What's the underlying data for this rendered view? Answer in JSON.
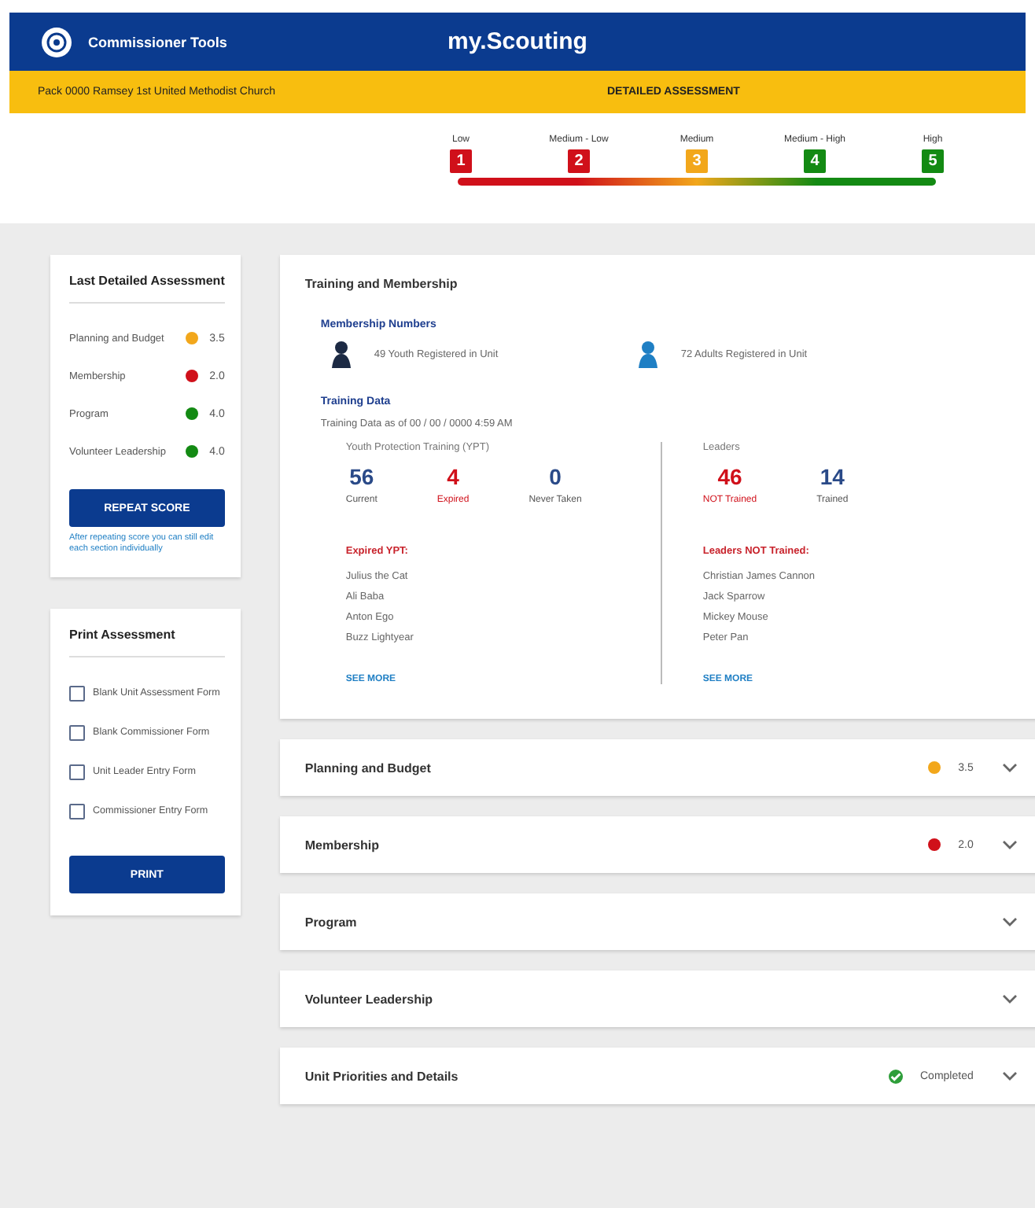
{
  "header": {
    "app_name": "Commissioner Tools",
    "title": "my.Scouting"
  },
  "subheader": {
    "unit": "Pack 0000 Ramsey 1st United Methodist Church",
    "page": "DETAILED ASSESSMENT"
  },
  "scale": [
    {
      "label": "Low",
      "number": "1",
      "color": "#d0101a"
    },
    {
      "label": "Medium - Low",
      "number": "2",
      "color": "#d0101a"
    },
    {
      "label": "Medium",
      "number": "3",
      "color": "#f2a71b"
    },
    {
      "label": "Medium - High",
      "number": "4",
      "color": "#138a13"
    },
    {
      "label": "High",
      "number": "5",
      "color": "#138a13"
    }
  ],
  "last_assessment": {
    "title": "Last Detailed Assessment",
    "scores": [
      {
        "name": "Planning and Budget",
        "color": "#f2a71b",
        "score": "3.5"
      },
      {
        "name": "Membership",
        "color": "#d0101a",
        "score": "2.0"
      },
      {
        "name": "Program",
        "color": "#138a13",
        "score": "4.0"
      },
      {
        "name": "Volunteer Leadership",
        "color": "#138a13",
        "score": "4.0"
      }
    ],
    "button": "REPEAT SCORE",
    "hint": "After repeating score you can still edit each section individually"
  },
  "print_assessment": {
    "title": "Print Assessment",
    "forms": [
      {
        "label": "Blank Unit Assessment Form",
        "checked": false
      },
      {
        "label": "Blank Commissioner Form",
        "checked": false
      },
      {
        "label": "Unit Leader Entry Form",
        "checked": false
      },
      {
        "label": "Commissioner Entry Form",
        "checked": false
      }
    ],
    "button": "PRINT"
  },
  "sections": [
    {
      "title": "Training and Membership",
      "expanded": true
    },
    {
      "title": "Planning and Budget",
      "expanded": false,
      "color": "#f2a71b",
      "score": "3.5"
    },
    {
      "title": "Membership",
      "expanded": false,
      "color": "#d0101a",
      "score": "2.0"
    },
    {
      "title": "Program",
      "expanded": false
    },
    {
      "title": "Volunteer Leadership",
      "expanded": false
    },
    {
      "title": "Unit Priorities and Details",
      "expanded": false,
      "color": "#2e9e3a",
      "status": "Completed"
    }
  ],
  "training_membership": {
    "membership_heading": "Membership Numbers",
    "youth": "49 Youth Registered in Unit",
    "adults": "72 Adults Registered in Unit",
    "training_heading": "Training Data",
    "training_date": "Training Data as of  00 / 00 / 0000   4:59 AM",
    "ypt": {
      "heading": "Youth Protection Training (YPT)",
      "stats": [
        {
          "value": "56",
          "label": "Current",
          "alert": false
        },
        {
          "value": "4",
          "label": "Expired",
          "alert": true
        },
        {
          "value": "0",
          "label": "Never Taken",
          "alert": false
        }
      ],
      "list_heading": "Expired YPT:",
      "names": [
        "Julius the Cat",
        "Ali Baba",
        "Anton Ego",
        "Buzz Lightyear"
      ],
      "link": "SEE MORE"
    },
    "leaders": {
      "heading": "Leaders",
      "stats": [
        {
          "value": "46",
          "label": "NOT Trained",
          "alert": true
        },
        {
          "value": "14",
          "label": "Trained",
          "alert": false
        }
      ],
      "list_heading": "Leaders NOT Trained:",
      "names": [
        "Christian James Cannon",
        "Jack Sparrow",
        "Mickey Mouse",
        "Peter Pan"
      ],
      "link": "SEE MORE"
    }
  }
}
